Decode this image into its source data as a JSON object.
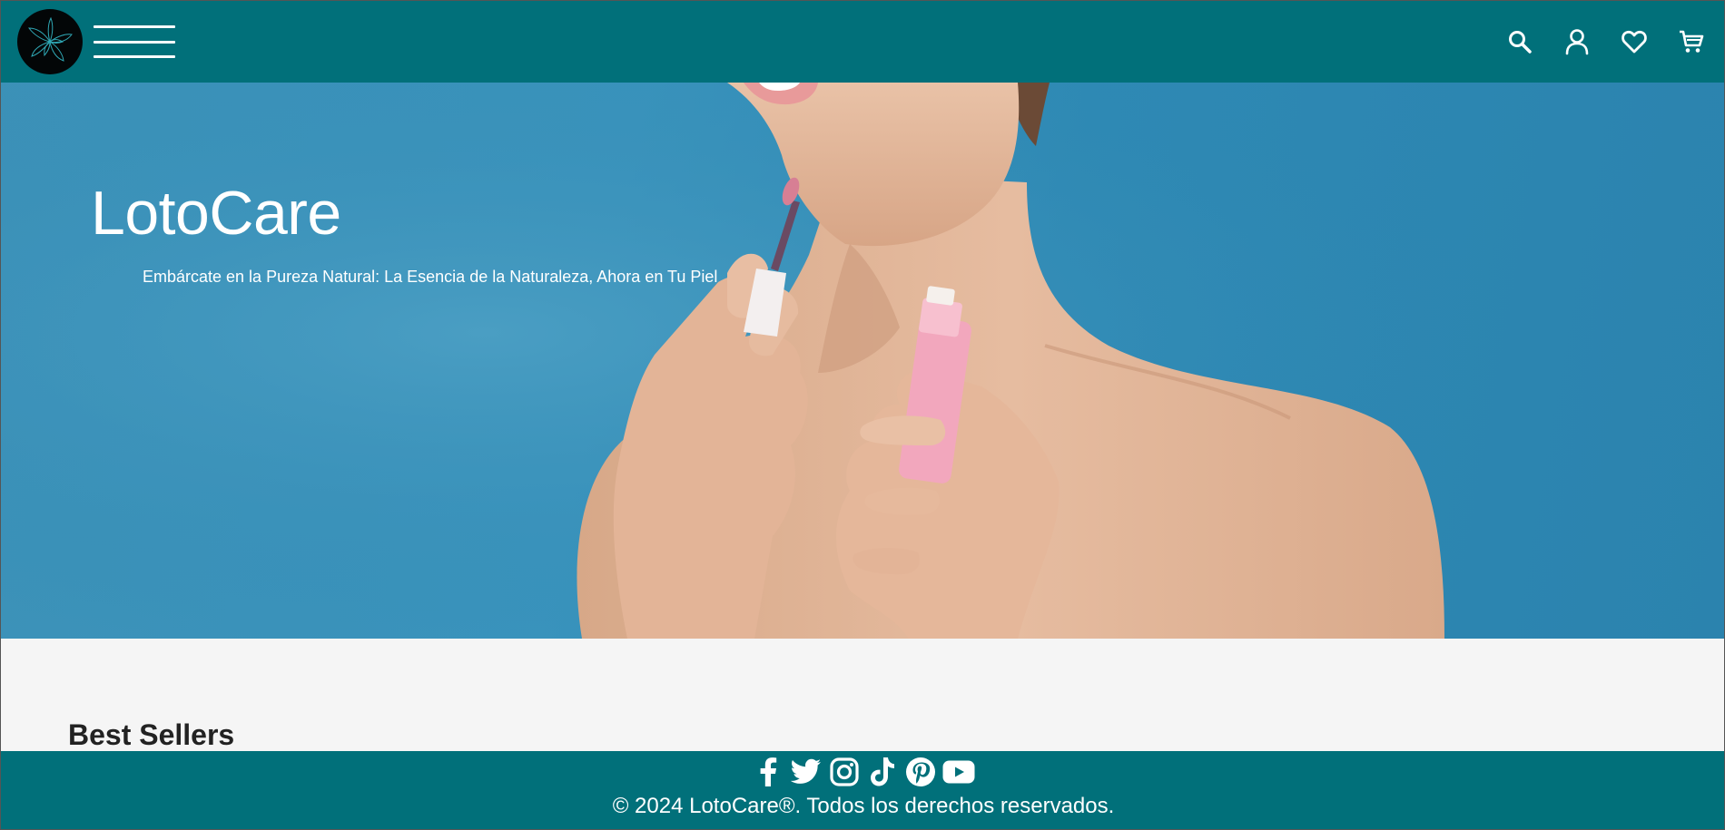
{
  "header": {
    "logo_name": "lotus-logo",
    "menu_icon": "hamburger-menu-icon",
    "icons": [
      "search-icon",
      "user-icon",
      "heart-icon",
      "cart-icon"
    ]
  },
  "hero": {
    "title": "LotoCare",
    "subtitle": "Embárcate en la Pureza Natural: La Esencia de la Naturaleza, Ahora en Tu Piel"
  },
  "best_sellers": {
    "title": "Best Sellers"
  },
  "footer": {
    "social_icons": [
      "facebook-icon",
      "twitter-icon",
      "instagram-icon",
      "tiktok-icon",
      "pinterest-icon",
      "youtube-icon"
    ],
    "copyright": "© 2024 LotoCare®. Todos los derechos reservados."
  },
  "colors": {
    "brand": "#01707a",
    "hero_bg": "#3a94bd",
    "page_bg": "#f5f5f5",
    "text_dark": "#222222"
  }
}
